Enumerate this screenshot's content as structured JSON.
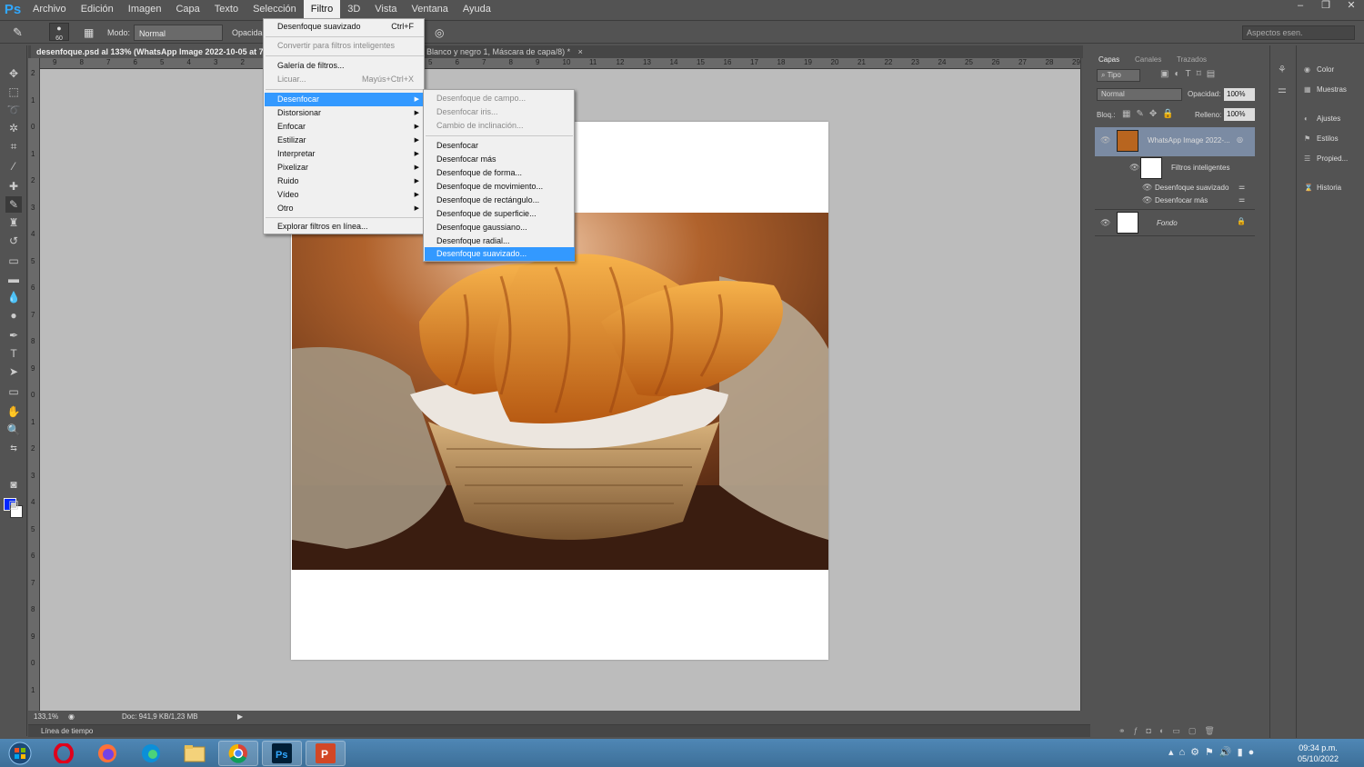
{
  "app": {
    "logo": "Ps"
  },
  "menubar": [
    "Archivo",
    "Edición",
    "Imagen",
    "Capa",
    "Texto",
    "Selección",
    "Filtro",
    "3D",
    "Vista",
    "Ventana",
    "Ayuda"
  ],
  "window_controls": [
    "–",
    "❐",
    "✕"
  ],
  "options": {
    "brush_size": "60",
    "mode_label": "Modo:",
    "mode_value": "Normal",
    "opacity_label": "Opacidad",
    "workspace": "Aspectos esen."
  },
  "doc_tabs": {
    "active": "desenfoque.psd al 133% (WhatsApp Image 2022-10-05 at 7.2",
    "second": "Blanco y negro 1, Máscara de capa/8) *",
    "close": "×"
  },
  "hruler_ticks": [
    "9",
    "8",
    "7",
    "6",
    "5",
    "4",
    "3",
    "2",
    "1",
    "0",
    "1",
    "2",
    "3",
    "4",
    "5",
    "6",
    "7",
    "8",
    "9",
    "10",
    "11",
    "12",
    "13",
    "14",
    "15",
    "16",
    "17",
    "18",
    "19",
    "20",
    "21",
    "22",
    "23",
    "24",
    "25",
    "26",
    "27",
    "28",
    "29"
  ],
  "vruler_ticks": [
    "2",
    "1",
    "0",
    "1",
    "2",
    "3",
    "4",
    "5",
    "6",
    "7",
    "8",
    "9",
    "0",
    "1",
    "2",
    "3",
    "4",
    "5",
    "6",
    "7",
    "8",
    "9",
    "0",
    "1",
    "2"
  ],
  "filter_menu": {
    "items": [
      {
        "label": "Desenfoque suavizado",
        "shortcut": "Ctrl+F",
        "disabled": false
      },
      {
        "label": "Convertir para filtros inteligentes",
        "disabled": true
      },
      {
        "label": "Galería de filtros...",
        "disabled": false
      },
      {
        "label": "Licuar...",
        "shortcut": "Mayús+Ctrl+X",
        "disabled": true
      },
      {
        "label": "Desenfocar",
        "submenu": true,
        "selected": true
      },
      {
        "label": "Distorsionar",
        "submenu": true
      },
      {
        "label": "Enfocar",
        "submenu": true
      },
      {
        "label": "Estilizar",
        "submenu": true
      },
      {
        "label": "Interpretar",
        "submenu": true
      },
      {
        "label": "Pixelizar",
        "submenu": true
      },
      {
        "label": "Ruido",
        "submenu": true
      },
      {
        "label": "Vídeo",
        "submenu": true
      },
      {
        "label": "Otro",
        "submenu": true
      },
      {
        "label": "Explorar filtros en línea..."
      }
    ]
  },
  "blur_submenu": [
    {
      "label": "Desenfoque de campo...",
      "disabled": true
    },
    {
      "label": "Desenfocar iris...",
      "disabled": true
    },
    {
      "label": "Cambio de inclinación...",
      "disabled": true
    },
    {
      "label": "Desenfocar"
    },
    {
      "label": "Desenfocar más"
    },
    {
      "label": "Desenfoque de forma..."
    },
    {
      "label": "Desenfoque de movimiento..."
    },
    {
      "label": "Desenfoque de rectángulo..."
    },
    {
      "label": "Desenfoque de superficie..."
    },
    {
      "label": "Desenfoque gaussiano..."
    },
    {
      "label": "Desenfoque radial..."
    },
    {
      "label": "Desenfoque suavizado...",
      "selected": true
    }
  ],
  "status": {
    "zoom": "133,1%",
    "doc": "Doc: 941,9 KB/1,23 MB",
    "timeline": "Línea de tiempo"
  },
  "layers_panel": {
    "tabs": [
      "Capas",
      "Canales",
      "Trazados"
    ],
    "kind": "Tipo",
    "blend": "Normal",
    "opacity_label": "Opacidad:",
    "opacity": "100%",
    "lock_label": "Bloq.:",
    "fill_label": "Relleno:",
    "fill": "100%",
    "layers": {
      "l1": "WhatsApp Image 2022-...",
      "smart": "Filtros inteligentes",
      "f1": "Desenfoque suavizado",
      "f2": "Desenfocar más",
      "bg": "Fondo"
    }
  },
  "right_panels": [
    "Color",
    "Muestras",
    "Ajustes",
    "Estilos",
    "Propied...",
    "Historia"
  ],
  "taskbar": {
    "time": "09:34 p.m.",
    "date": "05/10/2022"
  }
}
